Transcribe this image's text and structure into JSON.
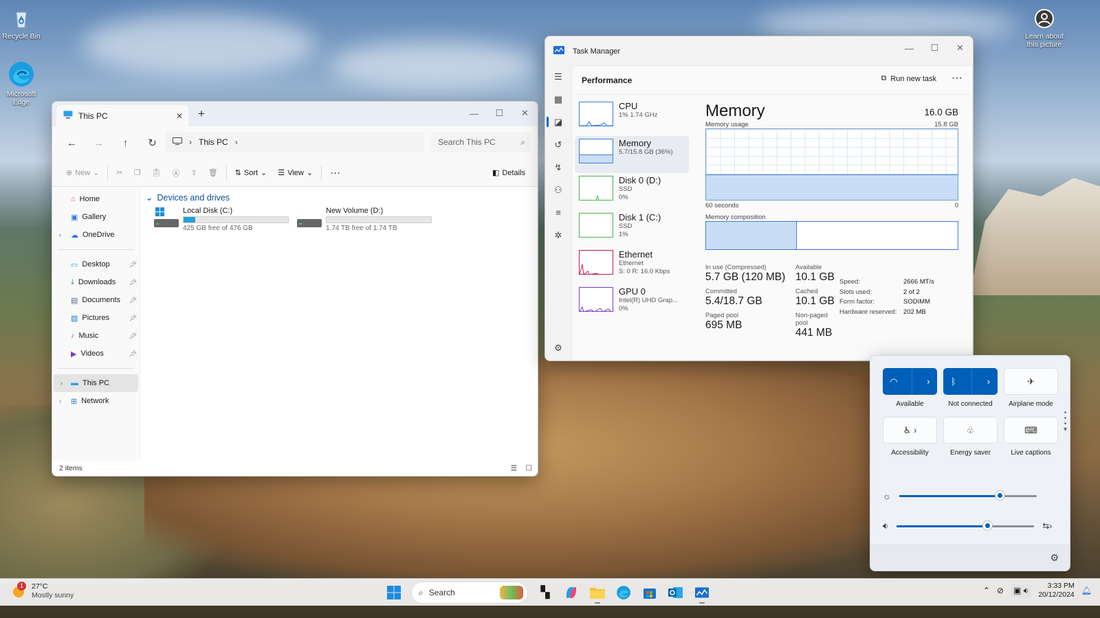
{
  "desktop": {
    "icons": [
      {
        "label": "Recycle Bin",
        "icon": "recycle-bin-icon"
      },
      {
        "label": "Microsoft Edge",
        "icon": "edge-icon"
      }
    ],
    "learn_about": "Learn about this picture"
  },
  "explorer": {
    "tab_title": "This PC",
    "breadcrumb": "This PC",
    "search_placeholder": "Search This PC",
    "commands": {
      "new": "New",
      "sort": "Sort",
      "view": "View",
      "details": "Details"
    },
    "nav": {
      "top": [
        {
          "label": "Home",
          "icon": "home-icon"
        },
        {
          "label": "Gallery",
          "icon": "gallery-icon"
        },
        {
          "label": "OneDrive",
          "icon": "onedrive-icon"
        }
      ],
      "quick_access": [
        {
          "label": "Desktop",
          "icon": "desktop-folder-icon"
        },
        {
          "label": "Downloads",
          "icon": "download-icon"
        },
        {
          "label": "Documents",
          "icon": "documents-icon"
        },
        {
          "label": "Pictures",
          "icon": "pictures-icon"
        },
        {
          "label": "Music",
          "icon": "music-icon"
        },
        {
          "label": "Videos",
          "icon": "videos-icon"
        }
      ],
      "bottom": [
        {
          "label": "This PC",
          "icon": "this-pc-icon"
        },
        {
          "label": "Network",
          "icon": "network-icon"
        }
      ]
    },
    "section_title": "Devices and drives",
    "drives": [
      {
        "name": "Local Disk (C:)",
        "free_text": "425 GB free of 476 GB",
        "used_fraction": 0.11
      },
      {
        "name": "New Volume (D:)",
        "free_text": "1.74 TB free of 1.74 TB",
        "used_fraction": 0.0
      }
    ],
    "status_count": "2 items"
  },
  "taskmgr": {
    "title": "Task Manager",
    "page": "Performance",
    "run_new_task": "Run new task",
    "perf_items": [
      {
        "name": "CPU",
        "sub1": "1% 1.74 GHz",
        "sub2": "",
        "sub3": ""
      },
      {
        "name": "Memory",
        "sub1": "5.7/15.8 GB (36%)",
        "sub2": "",
        "sub3": ""
      },
      {
        "name": "Disk 0 (D:)",
        "sub1": "SSD",
        "sub2": "0%",
        "sub3": ""
      },
      {
        "name": "Disk 1 (C:)",
        "sub1": "SSD",
        "sub2": "1%",
        "sub3": ""
      },
      {
        "name": "Ethernet",
        "sub1": "Ethernet",
        "sub2": "S: 0 R: 16.0 Kbps",
        "sub3": ""
      },
      {
        "name": "GPU 0",
        "sub1": "Intel(R) UHD Grap...",
        "sub2": "0%",
        "sub3": ""
      }
    ],
    "memory": {
      "title": "Memory",
      "total": "16.0 GB",
      "usage_label": "Memory usage",
      "usage_max": "15.8 GB",
      "time_left": "60 seconds",
      "time_right": "0",
      "usage_fraction": 0.36,
      "composition_label": "Memory composition",
      "in_use_fraction": 0.36,
      "stats": [
        {
          "label": "In use (Compressed)",
          "value": "5.7 GB (120 MB)"
        },
        {
          "label": "Available",
          "value": "10.1 GB"
        },
        {
          "label": "Committed",
          "value": "5.4/18.7 GB"
        },
        {
          "label": "Cached",
          "value": "10.1 GB"
        },
        {
          "label": "Paged pool",
          "value": "695 MB"
        },
        {
          "label": "Non-paged pool",
          "value": "441 MB"
        }
      ],
      "specs": [
        {
          "key": "Speed:",
          "value": "2666 MT/s"
        },
        {
          "key": "Slots used:",
          "value": "2 of 2"
        },
        {
          "key": "Form factor:",
          "value": "SODIMM"
        },
        {
          "key": "Hardware reserved:",
          "value": "202 MB"
        }
      ]
    }
  },
  "quick_settings": {
    "tiles": [
      {
        "label": "Available",
        "icon": "wifi-icon",
        "active": true
      },
      {
        "label": "Not connected",
        "icon": "bluetooth-icon",
        "active": true
      },
      {
        "label": "Airplane mode",
        "icon": "airplane-icon",
        "active": false
      },
      {
        "label": "Accessibility",
        "icon": "accessibility-icon",
        "active": false
      },
      {
        "label": "Energy saver",
        "icon": "energy-saver-icon",
        "active": false
      },
      {
        "label": "Live captions",
        "icon": "captions-icon",
        "active": false
      }
    ],
    "brightness_fraction": 0.73,
    "volume_fraction": 0.66
  },
  "taskbar": {
    "weather_temp": "27°C",
    "weather_text": "Mostly sunny",
    "weather_badge": "1",
    "search_label": "Search",
    "time": "3:33 PM",
    "date": "20/12/2024"
  },
  "colors": {
    "accent": "#005fb8",
    "drive_bar": "#26a0da",
    "memory_fill": "#c9ddf6"
  }
}
